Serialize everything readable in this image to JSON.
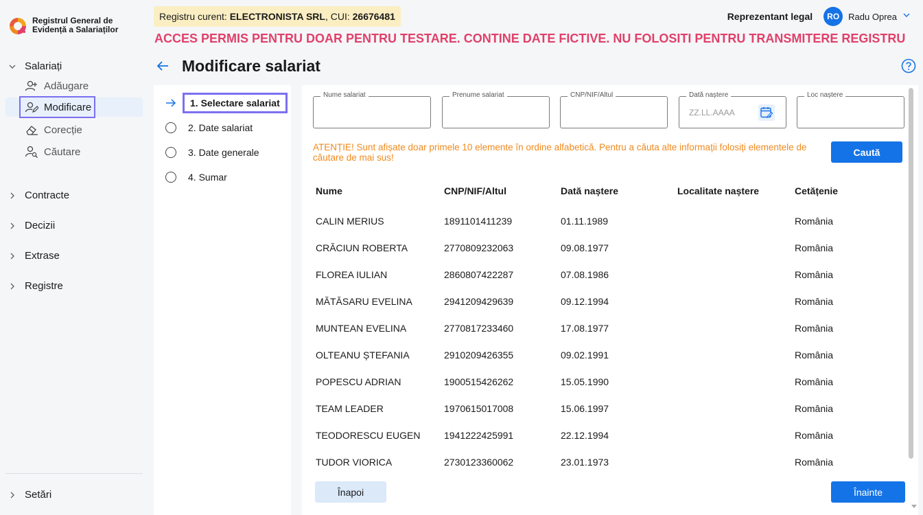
{
  "app": {
    "logo_line1": "Registrul General de",
    "logo_line2": "Evidență a Salariaților"
  },
  "header": {
    "registry_prefix": "Registru curent: ",
    "registry_company": "ELECTRONISTA SRL",
    "registry_cui_prefix": ", CUI: ",
    "registry_cui": "26676481",
    "warning": "ACCES PERMIS PENTRU DOAR PENTRU TESTARE. CONTINE DATE FICTIVE. NU FOLOSITI PENTRU TRANSMITERE REGISTRU",
    "role": "Reprezentant legal",
    "avatar_initials": "RO",
    "user_name": "Radu Oprea"
  },
  "sidebar": {
    "salariati": {
      "label": "Salariați",
      "items": [
        {
          "label": "Adăugare",
          "icon": "user-add-icon"
        },
        {
          "label": "Modificare",
          "icon": "user-edit-icon"
        },
        {
          "label": "Corecție",
          "icon": "eraser-icon"
        },
        {
          "label": "Căutare",
          "icon": "user-search-icon"
        }
      ]
    },
    "groups": [
      "Contracte",
      "Decizii",
      "Extrase",
      "Registre"
    ],
    "settings": "Setări"
  },
  "page": {
    "title": "Modificare salariat"
  },
  "stepper": {
    "steps": [
      "1. Selectare salariat",
      "2. Date salariat",
      "3. Date generale",
      "4. Sumar"
    ]
  },
  "search": {
    "fields": [
      {
        "label": "Nume salariat",
        "value": "",
        "placeholder": ""
      },
      {
        "label": "Prenume salariat",
        "value": "",
        "placeholder": ""
      },
      {
        "label": "CNP/NIF/Altul",
        "value": "",
        "placeholder": ""
      },
      {
        "label": "Dată naștere",
        "value": "",
        "placeholder": "ZZ.LL.AAAA"
      },
      {
        "label": "Loc naștere",
        "value": "",
        "placeholder": ""
      }
    ],
    "note": "ATENȚIE! Sunt afișate doar primele 10 elemente în ordine alfabetică. Pentru a căuta alte informații folosiți elementele de căutare de mai sus!",
    "search_button": "Caută"
  },
  "table": {
    "headers": [
      "Nume",
      "CNP/NIF/Altul",
      "Dată naștere",
      "Localitate naștere",
      "Cetățenie"
    ],
    "rows": [
      [
        "CALIN MERIUS",
        "1891101411239",
        "01.11.1989",
        "",
        "România"
      ],
      [
        "CRĂCIUN ROBERTA",
        "2770809232063",
        "09.08.1977",
        "",
        "România"
      ],
      [
        "FLOREA IULIAN",
        "2860807422287",
        "07.08.1986",
        "",
        "România"
      ],
      [
        "MĂTĂSARU  EVELINA",
        "2941209429639",
        "09.12.1994",
        "",
        "România"
      ],
      [
        "MUNTEAN EVELINA",
        "2770817233460",
        "17.08.1977",
        "",
        "România"
      ],
      [
        "OLTEANU  ȘTEFANIA",
        "2910209426355",
        "09.02.1991",
        "",
        "România"
      ],
      [
        "POPESCU ADRIAN",
        "1900515426262",
        "15.05.1990",
        "",
        "România"
      ],
      [
        "TEAM LEADER",
        "1970615017008",
        "15.06.1997",
        "",
        "România"
      ],
      [
        "TEODORESCU EUGEN",
        "1941222425991",
        "22.12.1994",
        "",
        "România"
      ],
      [
        "TUDOR VIORICA",
        "2730123360062",
        "23.01.1973",
        "",
        "România"
      ]
    ]
  },
  "footer": {
    "back_button": "Înapoi",
    "next_button": "Înainte"
  },
  "colors": {
    "accent": "#1473e6",
    "warning_red": "#e0406a",
    "note_orange": "#f08a1e",
    "focus_outline": "#7b6ff0"
  }
}
